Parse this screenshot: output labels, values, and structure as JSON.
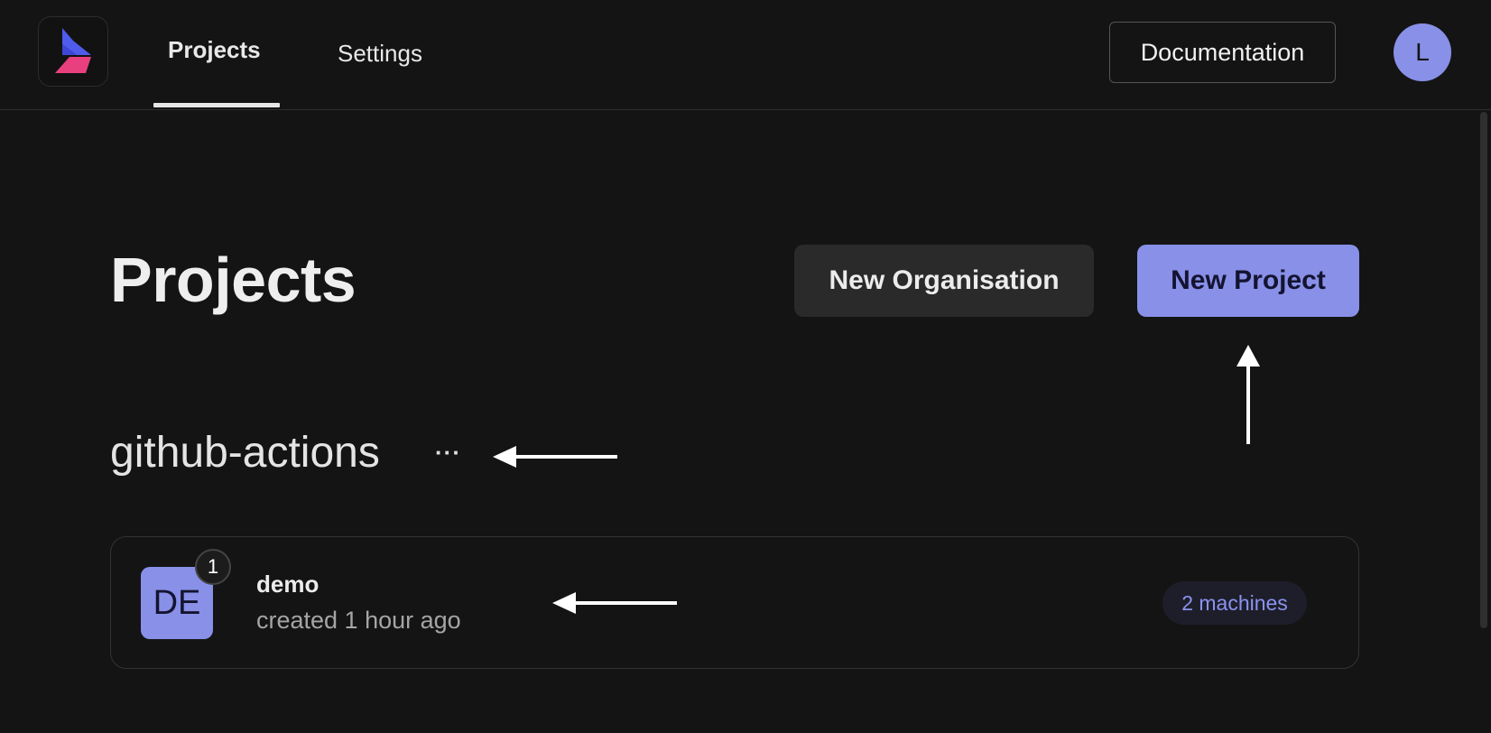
{
  "nav": {
    "tabs": [
      {
        "label": "Projects",
        "active": true
      },
      {
        "label": "Settings",
        "active": false
      }
    ],
    "documentation_label": "Documentation",
    "avatar_initial": "L"
  },
  "page": {
    "title": "Projects",
    "new_org_label": "New Organisation",
    "new_project_label": "New Project"
  },
  "organisation": {
    "name": "github-actions",
    "menu_label": "···",
    "projects": [
      {
        "initials": "DE",
        "badge_count": "1",
        "name": "demo",
        "created": "created 1 hour ago",
        "machines": "2 machines"
      }
    ]
  },
  "colors": {
    "background": "#141414",
    "accent": "#8890e8",
    "secondary_button": "#2a2a2a",
    "logo_blue": "#4f5bea",
    "logo_pink": "#e8407f"
  },
  "icons": [
    "logo-icon",
    "arrow-icon"
  ]
}
